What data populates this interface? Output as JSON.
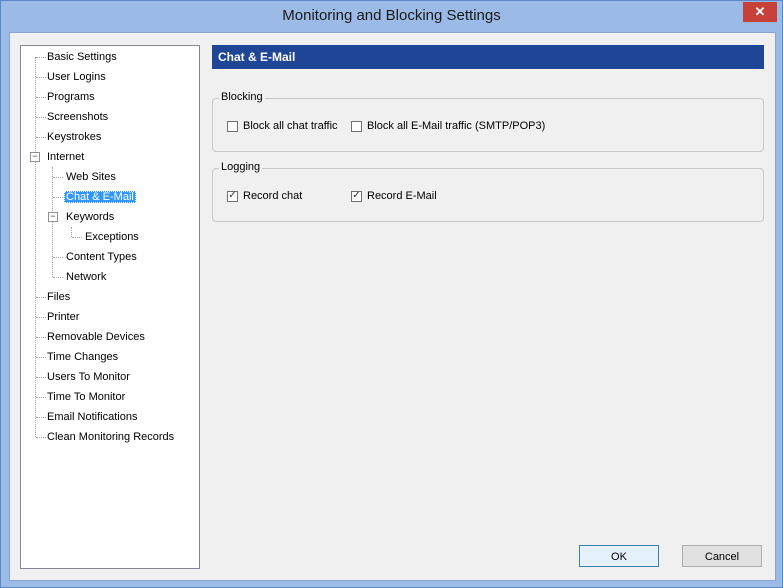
{
  "window": {
    "title": "Monitoring and Blocking Settings",
    "close_glyph": "✕"
  },
  "tree": {
    "items": [
      "Basic Settings",
      "User Logins",
      "Programs",
      "Screenshots",
      "Keystrokes",
      "Internet",
      "Web Sites",
      "Chat & E-Mail",
      "Keywords",
      "Exceptions",
      "Content Types",
      "Network",
      "Files",
      "Printer",
      "Removable Devices",
      "Time Changes",
      "Users To Monitor",
      "Time To Monitor",
      "Email Notifications",
      "Clean Monitoring Records"
    ],
    "selected": "Chat & E-Mail",
    "expander_glyph": "−"
  },
  "panel": {
    "header": "Chat & E-Mail",
    "blocking": {
      "legend": "Blocking",
      "block_chat": {
        "label": "Block all chat traffic",
        "checked": false
      },
      "block_email": {
        "label": "Block all E-Mail traffic (SMTP/POP3)",
        "checked": false
      }
    },
    "logging": {
      "legend": "Logging",
      "record_chat": {
        "label": "Record chat",
        "checked": true
      },
      "record_email": {
        "label": "Record E-Mail",
        "checked": true
      }
    },
    "check_glyph": "✓"
  },
  "buttons": {
    "ok": "OK",
    "cancel": "Cancel"
  }
}
